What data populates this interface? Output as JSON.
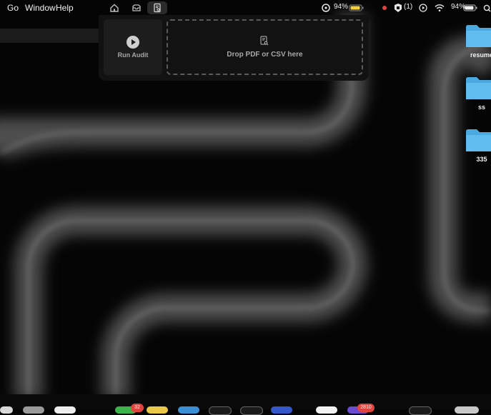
{
  "menubar": {
    "menus": [
      "Go",
      "Window",
      "Help"
    ],
    "battery_percent": "94%",
    "extension_count": "(1)",
    "battery_percent_right": "94%"
  },
  "toolbar": {
    "tabs": [
      {
        "icon": "home-icon"
      },
      {
        "icon": "inbox-icon"
      },
      {
        "icon": "document-search-icon",
        "active": true
      }
    ]
  },
  "panel": {
    "run_label": "Run Audit",
    "drop_label": "Drop PDF or CSV here"
  },
  "desktop": {
    "folders": [
      "resume",
      "ss",
      "335"
    ]
  },
  "dock": {
    "badges": [
      "32",
      "2810"
    ]
  },
  "colors": {
    "folder": "#5ab8ec",
    "battery": "#f4d03f",
    "badge": "#e0443e"
  }
}
